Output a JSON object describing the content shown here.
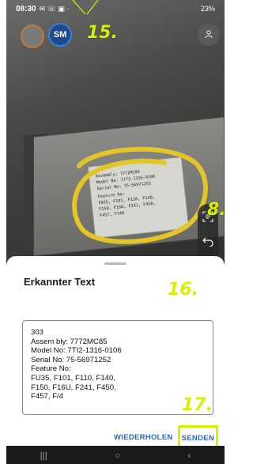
{
  "status_bar": {
    "time": "08:30",
    "left_icons": "✉ ☏ ▣ ·",
    "right_text": "23%"
  },
  "top_bar": {
    "avatar_initials": "SM"
  },
  "label_plate": {
    "lines": [
      "Assembly: 7772MC85",
      "Model No: 7772-1316-0106",
      "Serial No: 75-56971252",
      "Feature No:",
      "F035, F101, F110, F140,",
      "F150, F160, F241, F450,",
      "F457, F740"
    ]
  },
  "sheet": {
    "title": "Erkannter Text",
    "recognized_text": "303\nAssem bly: 7772MC85\nModel No: 7TI2-1316-0106\nSerial No: 75-56971252\nFeature No:\nFU35, F101, F110, F140,\nF150, F16U, F241, F450,\nF457, F/4",
    "repeat_label": "WIEDERHOLEN",
    "send_label": "SENDEN"
  },
  "annotations": {
    "a15": "15.",
    "a8": "8.",
    "a16": "16.",
    "a17": "17."
  },
  "colors": {
    "annotation": "#d7f200",
    "action_blue": "#2a66c8",
    "lasso": "#e3c52a"
  },
  "icons": {
    "profile": "person-icon",
    "scan": "scan-text-icon",
    "undo": "undo-icon",
    "delete": "trash-icon"
  }
}
